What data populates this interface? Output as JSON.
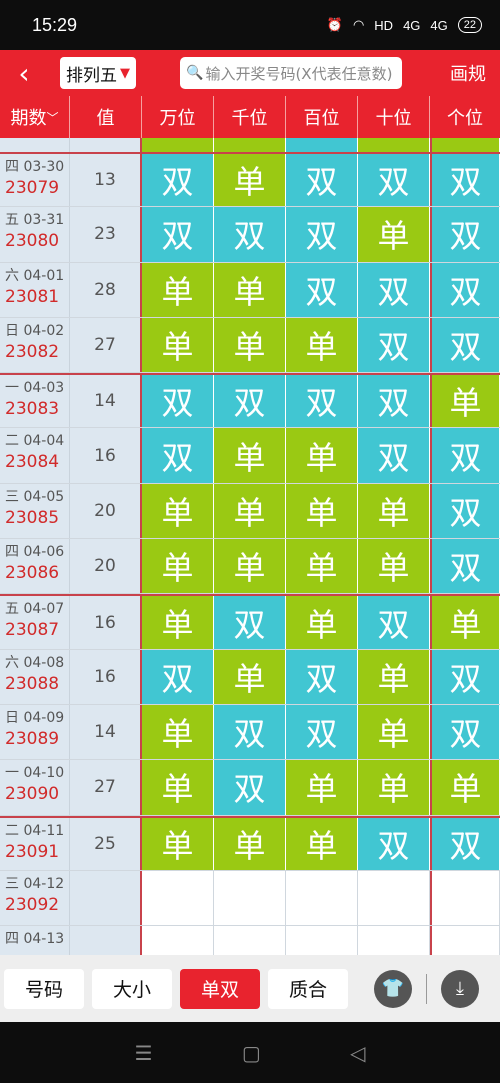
{
  "status": {
    "time": "15:29",
    "network": "HD",
    "signal1": "4G",
    "signal2": "4G",
    "battery": "22"
  },
  "appbar": {
    "game": "排列五",
    "search_placeholder": "输入开奖号码(X代表任意数)",
    "rules": "画规"
  },
  "columns": [
    "期数",
    "值",
    "万位",
    "千位",
    "百位",
    "十位",
    "个位"
  ],
  "rows": [
    {
      "date": "四 03-30",
      "issue": "23079",
      "value": "13",
      "pos": [
        "双",
        "单",
        "双",
        "双",
        "双"
      ]
    },
    {
      "date": "五 03-31",
      "issue": "23080",
      "value": "23",
      "pos": [
        "双",
        "双",
        "双",
        "单",
        "双"
      ]
    },
    {
      "date": "六 04-01",
      "issue": "23081",
      "value": "28",
      "pos": [
        "单",
        "单",
        "双",
        "双",
        "双"
      ]
    },
    {
      "date": "日 04-02",
      "issue": "23082",
      "value": "27",
      "pos": [
        "单",
        "单",
        "单",
        "双",
        "双"
      ]
    },
    {
      "date": "一 04-03",
      "issue": "23083",
      "value": "14",
      "pos": [
        "双",
        "双",
        "双",
        "双",
        "单"
      ]
    },
    {
      "date": "二 04-04",
      "issue": "23084",
      "value": "16",
      "pos": [
        "双",
        "单",
        "单",
        "双",
        "双"
      ]
    },
    {
      "date": "三 04-05",
      "issue": "23085",
      "value": "20",
      "pos": [
        "单",
        "单",
        "单",
        "单",
        "双"
      ]
    },
    {
      "date": "四 04-06",
      "issue": "23086",
      "value": "20",
      "pos": [
        "单",
        "单",
        "单",
        "单",
        "双"
      ]
    },
    {
      "date": "五 04-07",
      "issue": "23087",
      "value": "16",
      "pos": [
        "单",
        "双",
        "单",
        "双",
        "单"
      ]
    },
    {
      "date": "六 04-08",
      "issue": "23088",
      "value": "16",
      "pos": [
        "双",
        "单",
        "双",
        "单",
        "双"
      ]
    },
    {
      "date": "日 04-09",
      "issue": "23089",
      "value": "14",
      "pos": [
        "单",
        "双",
        "双",
        "单",
        "双"
      ]
    },
    {
      "date": "一 04-10",
      "issue": "23090",
      "value": "27",
      "pos": [
        "单",
        "双",
        "单",
        "单",
        "单"
      ]
    },
    {
      "date": "二 04-11",
      "issue": "23091",
      "value": "25",
      "pos": [
        "单",
        "单",
        "单",
        "双",
        "双"
      ]
    },
    {
      "date": "三 04-12",
      "issue": "23092",
      "value": "",
      "pos": [
        "",
        "",
        "",
        "",
        ""
      ]
    },
    {
      "date": "四 04-13",
      "issue": "",
      "value": "",
      "pos": [
        "",
        "",
        "",
        "",
        ""
      ]
    }
  ],
  "tabs": [
    {
      "label": "号码",
      "active": false
    },
    {
      "label": "大小",
      "active": false
    },
    {
      "label": "单双",
      "active": true
    },
    {
      "label": "质合",
      "active": false
    }
  ],
  "colors": {
    "accent": "#e8232e",
    "single": "#9ac913",
    "double": "#41c6d2"
  },
  "icons": {
    "back": "back-arrow-icon",
    "search": "search-icon",
    "shirt": "shirt-icon",
    "download": "download-icon"
  }
}
